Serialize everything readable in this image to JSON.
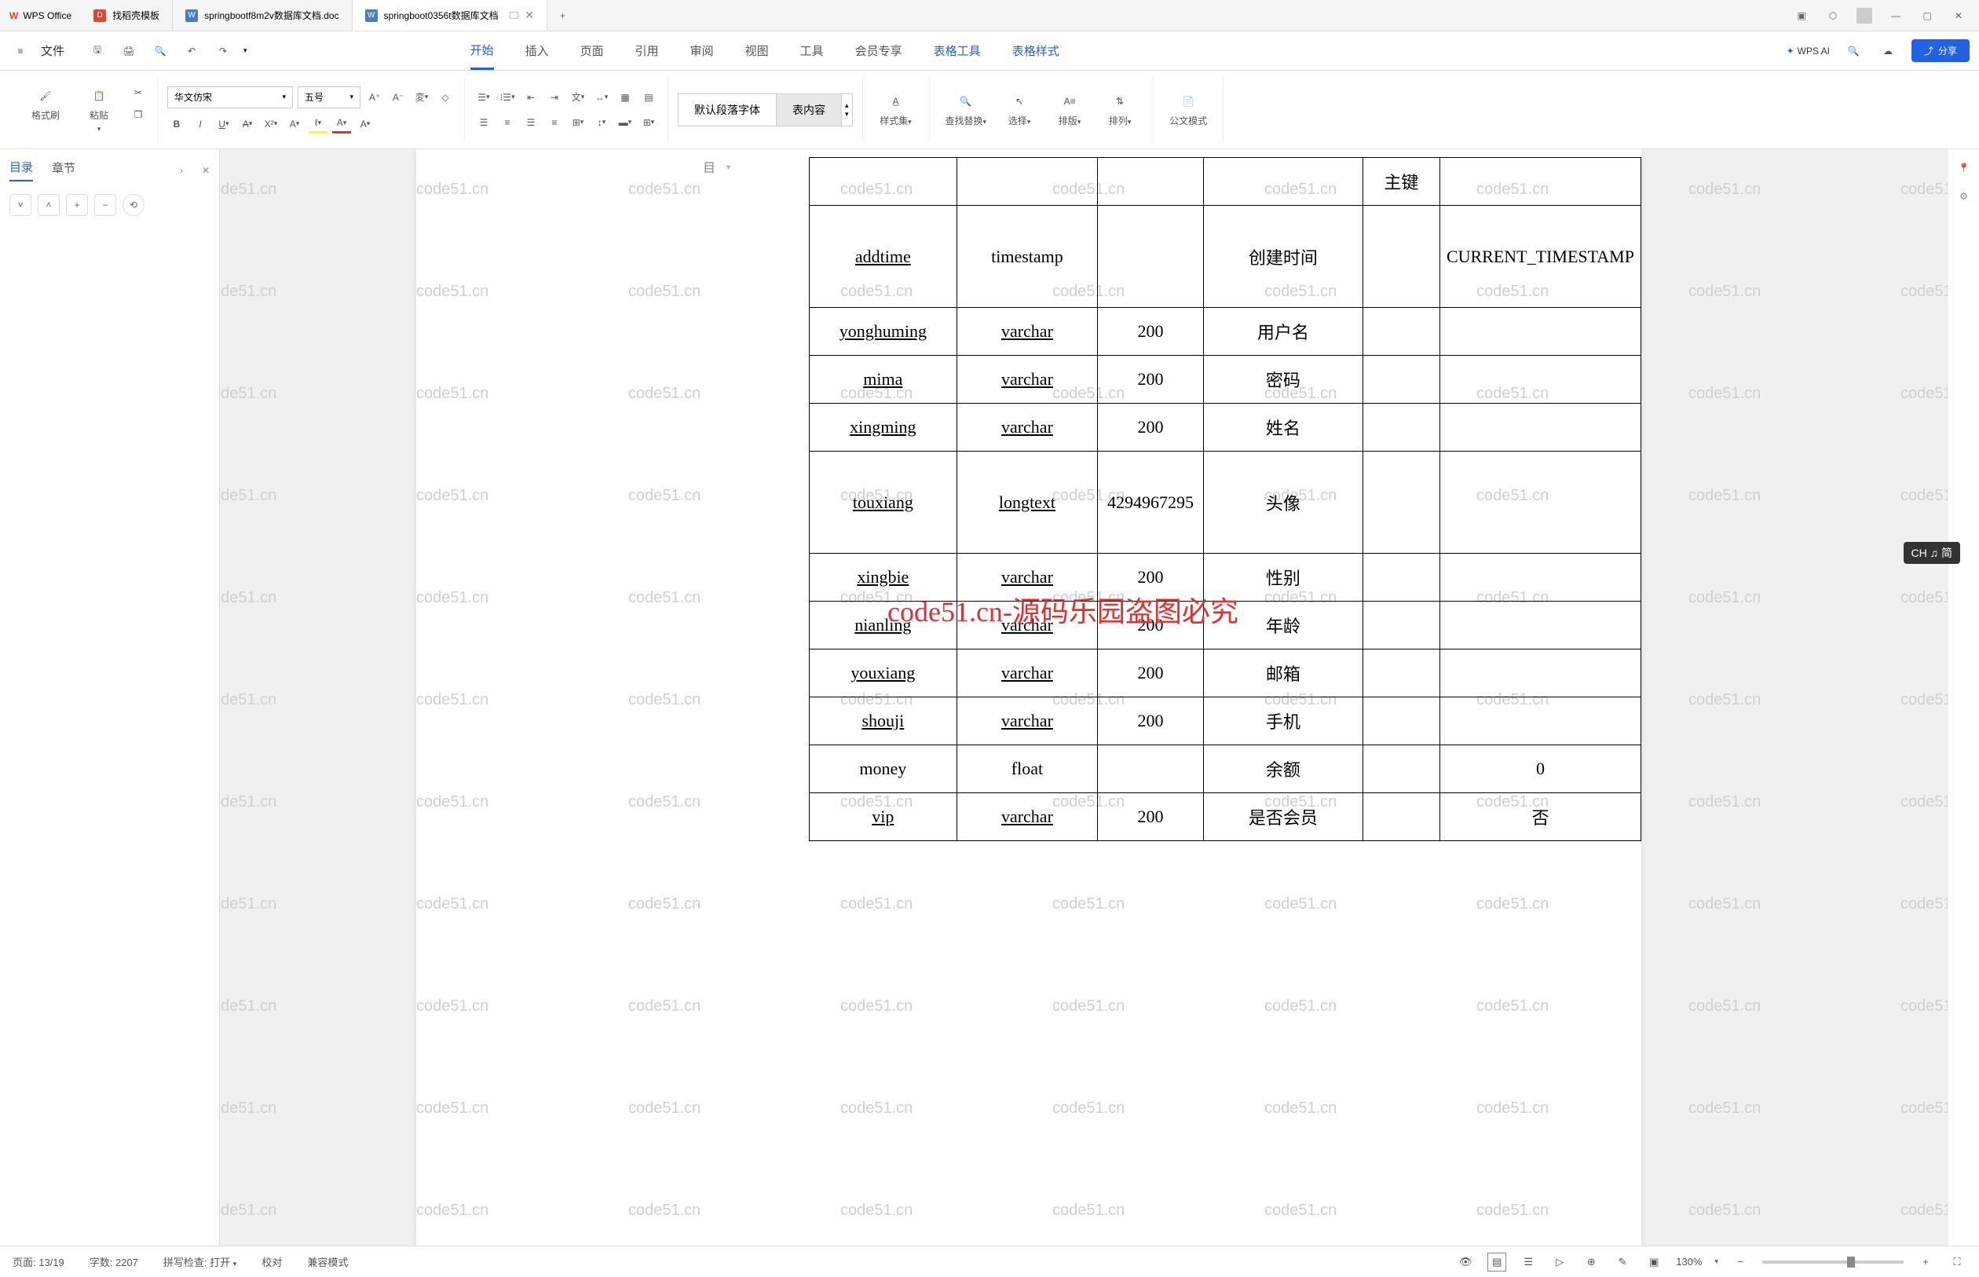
{
  "app_name": "WPS Office",
  "tabs": [
    {
      "label": "找稻壳模板",
      "icon_type": "red"
    },
    {
      "label": "springbootf8m2v数据库文档.doc",
      "icon_type": "word"
    },
    {
      "label": "springboot0356t数据库文档",
      "icon_type": "word",
      "active": true
    }
  ],
  "menu": {
    "file": "文件",
    "items": [
      "开始",
      "插入",
      "页面",
      "引用",
      "审阅",
      "视图",
      "工具",
      "会员专享",
      "表格工具",
      "表格样式"
    ],
    "active_item": "开始",
    "special_items": [
      "表格工具",
      "表格样式"
    ],
    "wps_ai": "WPS AI",
    "share": "分享"
  },
  "ribbon": {
    "format_brush": "格式刷",
    "paste": "粘贴",
    "font_name": "华文仿宋",
    "font_size": "五号",
    "paragraph_styles": {
      "default": "默认段落字体",
      "content": "表内容"
    },
    "style_set": "样式集",
    "find_replace": "查找替换",
    "select": "选择",
    "layout": "排版",
    "sort": "排列",
    "official_mode": "公文模式"
  },
  "sidebar": {
    "tab_toc": "目录",
    "tab_chapter": "章节"
  },
  "ruler_marker": "目",
  "table": {
    "header_key": "主键",
    "rows": [
      {
        "c1": "addtime",
        "c2": "timestamp",
        "c3": "",
        "c4": "创建时间",
        "c5": "",
        "c6": "CURRENT_TIMESTAMP",
        "tall": true,
        "u1": true
      },
      {
        "c1": "yonghuming",
        "c2": "varchar",
        "c3": "200",
        "c4": "用户名",
        "c5": "",
        "c6": "",
        "u1": true,
        "u2": true
      },
      {
        "c1": "mima",
        "c2": "varchar",
        "c3": "200",
        "c4": "密码",
        "c5": "",
        "c6": "",
        "u1": true,
        "u2": true
      },
      {
        "c1": "xingming",
        "c2": "varchar",
        "c3": "200",
        "c4": "姓名",
        "c5": "",
        "c6": "",
        "u1": true,
        "u2": true
      },
      {
        "c1": "touxiang",
        "c2": "longtext",
        "c3": "4294967295",
        "c4": "头像",
        "c5": "",
        "c6": "",
        "tall": true,
        "u1": true,
        "u2": true
      },
      {
        "c1": "xingbie",
        "c2": "varchar",
        "c3": "200",
        "c4": "性别",
        "c5": "",
        "c6": "",
        "u1": true,
        "u2": true
      },
      {
        "c1": "nianling",
        "c2": "varchar",
        "c3": "200",
        "c4": "年龄",
        "c5": "",
        "c6": "",
        "u1": true,
        "u2": true
      },
      {
        "c1": "youxiang",
        "c2": "varchar",
        "c3": "200",
        "c4": "邮箱",
        "c5": "",
        "c6": "",
        "u1": true,
        "u2": true
      },
      {
        "c1": "shouji",
        "c2": "varchar",
        "c3": "200",
        "c4": "手机",
        "c5": "",
        "c6": "",
        "u1": true,
        "u2": true
      },
      {
        "c1": "money",
        "c2": "float",
        "c3": "",
        "c4": "余额",
        "c5": "",
        "c6": "0"
      },
      {
        "c1": "vip",
        "c2": "varchar",
        "c3": "200",
        "c4": "是否会员",
        "c5": "",
        "c6": "否",
        "u1": true,
        "u2": true
      }
    ]
  },
  "watermark_text": "code51.cn",
  "watermark_red": "code51.cn-源码乐园盗图必究",
  "status": {
    "page": "页面: 13/19",
    "words": "字数: 2207",
    "spell": "拼写检查: 打开",
    "proofing": "校对",
    "compat": "兼容模式",
    "zoom": "130%"
  },
  "ime": "CH ♫ 简"
}
